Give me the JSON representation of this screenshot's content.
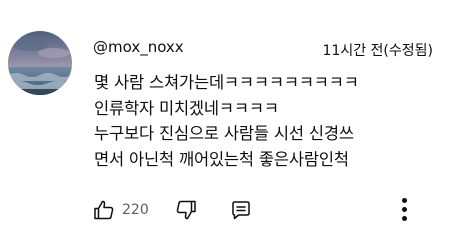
{
  "comment": {
    "author": "@mox_noxx",
    "timestamp": "11시간 전(수정됨)",
    "lines": [
      "몇 사람 스쳐가는데ㅋㅋㅋㅋㅋㅋㅋㅋㅋ",
      "인류학자 미치겠네ㅋㅋㅋㅋ",
      "누구보다 진심으로 사람들 시선 신경쓰",
      "면서 아닌척 깨어있는척 좋은사람인척"
    ],
    "like_count": "220"
  },
  "icons": {
    "avatar": "avatar-sea-sunset",
    "like": "thumbs-up-icon",
    "dislike": "thumbs-down-icon",
    "reply": "reply-icon",
    "more": "more-vertical-icon"
  },
  "colors": {
    "text": "#0f0f0f",
    "secondary_text": "#606060",
    "background": "#ffffff"
  }
}
